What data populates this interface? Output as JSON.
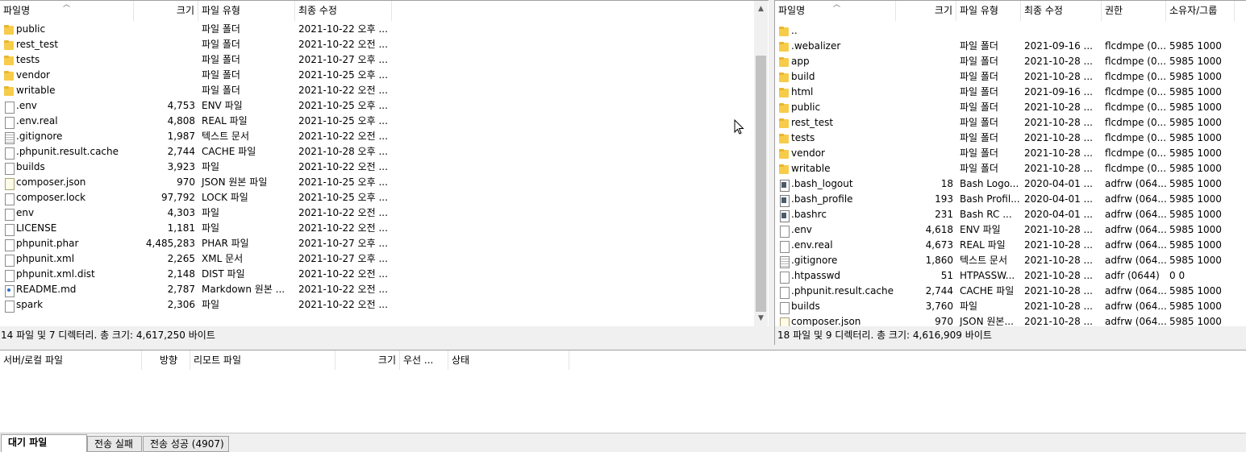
{
  "local": {
    "columns": {
      "name": "파일명",
      "size": "크기",
      "type": "파일 유형",
      "modified": "최종 수정"
    },
    "rows": [
      {
        "name": "public",
        "size": "",
        "type": "파일 폴더",
        "modified": "2021-10-22 오후 ...",
        "icon": "folder"
      },
      {
        "name": "rest_test",
        "size": "",
        "type": "파일 폴더",
        "modified": "2021-10-22 오전 ...",
        "icon": "folder"
      },
      {
        "name": "tests",
        "size": "",
        "type": "파일 폴더",
        "modified": "2021-10-27 오후 ...",
        "icon": "folder"
      },
      {
        "name": "vendor",
        "size": "",
        "type": "파일 폴더",
        "modified": "2021-10-25 오후 ...",
        "icon": "folder"
      },
      {
        "name": "writable",
        "size": "",
        "type": "파일 폴더",
        "modified": "2021-10-22 오전 ...",
        "icon": "folder"
      },
      {
        "name": ".env",
        "size": "4,753",
        "type": "ENV 파일",
        "modified": "2021-10-25 오후 ...",
        "icon": "file"
      },
      {
        "name": ".env.real",
        "size": "4,808",
        "type": "REAL 파일",
        "modified": "2021-10-25 오후 ...",
        "icon": "file"
      },
      {
        "name": ".gitignore",
        "size": "1,987",
        "type": "텍스트 문서",
        "modified": "2021-10-22 오전 ...",
        "icon": "text"
      },
      {
        "name": ".phpunit.result.cache",
        "size": "2,744",
        "type": "CACHE 파일",
        "modified": "2021-10-28 오후 ...",
        "icon": "file"
      },
      {
        "name": "builds",
        "size": "3,923",
        "type": "파일",
        "modified": "2021-10-22 오전 ...",
        "icon": "file"
      },
      {
        "name": "composer.json",
        "size": "970",
        "type": "JSON 원본 파일",
        "modified": "2021-10-25 오후 ...",
        "icon": "json"
      },
      {
        "name": "composer.lock",
        "size": "97,792",
        "type": "LOCK 파일",
        "modified": "2021-10-25 오후 ...",
        "icon": "file"
      },
      {
        "name": "env",
        "size": "4,303",
        "type": "파일",
        "modified": "2021-10-22 오전 ...",
        "icon": "file"
      },
      {
        "name": "LICENSE",
        "size": "1,181",
        "type": "파일",
        "modified": "2021-10-22 오전 ...",
        "icon": "file"
      },
      {
        "name": "phpunit.phar",
        "size": "4,485,283",
        "type": "PHAR 파일",
        "modified": "2021-10-27 오후 ...",
        "icon": "file"
      },
      {
        "name": "phpunit.xml",
        "size": "2,265",
        "type": "XML 문서",
        "modified": "2021-10-27 오후 ...",
        "icon": "file"
      },
      {
        "name": "phpunit.xml.dist",
        "size": "2,148",
        "type": "DIST 파일",
        "modified": "2021-10-22 오전 ...",
        "icon": "file"
      },
      {
        "name": "README.md",
        "size": "2,787",
        "type": "Markdown 원본 ...",
        "modified": "2021-10-22 오전 ...",
        "icon": "md"
      },
      {
        "name": "spark",
        "size": "2,306",
        "type": "파일",
        "modified": "2021-10-22 오전 ...",
        "icon": "file"
      }
    ],
    "status": "14 파일 및 7 디렉터리. 총 크기: 4,617,250 바이트"
  },
  "remote": {
    "columns": {
      "name": "파일명",
      "size": "크기",
      "type": "파일 유형",
      "modified": "최종 수정",
      "perm": "권한",
      "owner": "소유자/그룹"
    },
    "rows": [
      {
        "name": "..",
        "size": "",
        "type": "",
        "modified": "",
        "perm": "",
        "owner": "",
        "icon": "folder"
      },
      {
        "name": ".webalizer",
        "size": "",
        "type": "파일 폴더",
        "modified": "2021-09-16 ...",
        "perm": "flcdmpe (0...",
        "owner": "5985 1000",
        "icon": "folder"
      },
      {
        "name": "app",
        "size": "",
        "type": "파일 폴더",
        "modified": "2021-10-28 ...",
        "perm": "flcdmpe (0...",
        "owner": "5985 1000",
        "icon": "folder"
      },
      {
        "name": "build",
        "size": "",
        "type": "파일 폴더",
        "modified": "2021-10-28 ...",
        "perm": "flcdmpe (0...",
        "owner": "5985 1000",
        "icon": "folder"
      },
      {
        "name": "html",
        "size": "",
        "type": "파일 폴더",
        "modified": "2021-09-16 ...",
        "perm": "flcdmpe (0...",
        "owner": "5985 1000",
        "icon": "folder"
      },
      {
        "name": "public",
        "size": "",
        "type": "파일 폴더",
        "modified": "2021-10-28 ...",
        "perm": "flcdmpe (0...",
        "owner": "5985 1000",
        "icon": "folder"
      },
      {
        "name": "rest_test",
        "size": "",
        "type": "파일 폴더",
        "modified": "2021-10-28 ...",
        "perm": "flcdmpe (0...",
        "owner": "5985 1000",
        "icon": "folder"
      },
      {
        "name": "tests",
        "size": "",
        "type": "파일 폴더",
        "modified": "2021-10-28 ...",
        "perm": "flcdmpe (0...",
        "owner": "5985 1000",
        "icon": "folder"
      },
      {
        "name": "vendor",
        "size": "",
        "type": "파일 폴더",
        "modified": "2021-10-28 ...",
        "perm": "flcdmpe (0...",
        "owner": "5985 1000",
        "icon": "folder"
      },
      {
        "name": "writable",
        "size": "",
        "type": "파일 폴더",
        "modified": "2021-10-28 ...",
        "perm": "flcdmpe (0...",
        "owner": "5985 1000",
        "icon": "folder"
      },
      {
        "name": ".bash_logout",
        "size": "18",
        "type": "Bash Logo...",
        "modified": "2020-04-01 ...",
        "perm": "adfrw (064...",
        "owner": "5985 1000",
        "icon": "script"
      },
      {
        "name": ".bash_profile",
        "size": "193",
        "type": "Bash Profil...",
        "modified": "2020-04-01 ...",
        "perm": "adfrw (064...",
        "owner": "5985 1000",
        "icon": "script"
      },
      {
        "name": ".bashrc",
        "size": "231",
        "type": "Bash RC ...",
        "modified": "2020-04-01 ...",
        "perm": "adfrw (064...",
        "owner": "5985 1000",
        "icon": "script"
      },
      {
        "name": ".env",
        "size": "4,618",
        "type": "ENV 파일",
        "modified": "2021-10-28 ...",
        "perm": "adfrw (064...",
        "owner": "5985 1000",
        "icon": "file"
      },
      {
        "name": ".env.real",
        "size": "4,673",
        "type": "REAL 파일",
        "modified": "2021-10-28 ...",
        "perm": "adfrw (064...",
        "owner": "5985 1000",
        "icon": "file"
      },
      {
        "name": ".gitignore",
        "size": "1,860",
        "type": "텍스트 문서",
        "modified": "2021-10-28 ...",
        "perm": "adfrw (064...",
        "owner": "5985 1000",
        "icon": "text"
      },
      {
        "name": ".htpasswd",
        "size": "51",
        "type": "HTPASSW...",
        "modified": "2021-10-28 ...",
        "perm": "adfr (0644)",
        "owner": "0 0",
        "icon": "file"
      },
      {
        "name": ".phpunit.result.cache",
        "size": "2,744",
        "type": "CACHE 파일",
        "modified": "2021-10-28 ...",
        "perm": "adfrw (064...",
        "owner": "5985 1000",
        "icon": "file"
      },
      {
        "name": "builds",
        "size": "3,760",
        "type": "파일",
        "modified": "2021-10-28 ...",
        "perm": "adfrw (064...",
        "owner": "5985 1000",
        "icon": "file"
      },
      {
        "name": "composer.json",
        "size": "970",
        "type": "JSON 원본...",
        "modified": "2021-10-28 ...",
        "perm": "adfrw (064...",
        "owner": "5985 1000",
        "icon": "json"
      }
    ],
    "status": "18 파일 및 9 디렉터리. 총 크기: 4,616,909 바이트"
  },
  "queue": {
    "columns": {
      "local_file": "서버/로컬 파일",
      "direction": "방향",
      "remote_file": "리모트 파일",
      "size": "크기",
      "priority": "우선 ...",
      "status": "상태"
    }
  },
  "tabs": [
    {
      "label": "대기 파일"
    },
    {
      "label": "전송 실패"
    },
    {
      "label": "전송 성공 (4907)"
    }
  ]
}
